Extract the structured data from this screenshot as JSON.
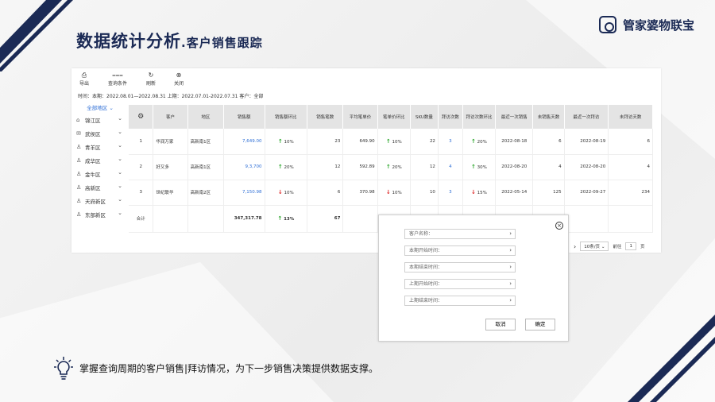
{
  "slide": {
    "title_main": "数据统计分析",
    "title_sub": ".客户销售跟踪",
    "brand_name": "管家婆物联宝",
    "caption": "掌握查询周期的客户销售|拜访情况，为下一步销售决策提供数据支撑。"
  },
  "toolbar": {
    "items": [
      {
        "label": "导出",
        "icon": "export-icon"
      },
      {
        "label": "查询条件",
        "icon": "filter-icon"
      },
      {
        "label": "刷新",
        "icon": "refresh-icon"
      },
      {
        "label": "关闭",
        "icon": "close-icon"
      }
    ]
  },
  "filter": {
    "text": "时间：本期：2022.08.01—2022.08.31  上期：2022.07.01-2022.07.31    客户：全部"
  },
  "sidebar": {
    "all_label": "全部地区",
    "items": [
      {
        "label": "锦江区",
        "icon": "home-icon"
      },
      {
        "label": "武侯区",
        "icon": "mail-icon"
      },
      {
        "label": "青羊区",
        "icon": "user-icon"
      },
      {
        "label": "成华区",
        "icon": "user-icon"
      },
      {
        "label": "金牛区",
        "icon": "user-icon"
      },
      {
        "label": "高新区",
        "icon": "user-icon"
      },
      {
        "label": "天府新区",
        "icon": "user-icon"
      },
      {
        "label": "东部新区",
        "icon": "user-icon"
      }
    ]
  },
  "table": {
    "headers": [
      "客户",
      "地区",
      "销售额",
      "销售额环比",
      "销售笔数",
      "平均笔单价",
      "笔单价环比",
      "SKU数量",
      "拜访次数",
      "拜访次数环比",
      "最近一次销售",
      "未销售天数",
      "最近一次拜访",
      "未拜访天数"
    ],
    "rows": [
      {
        "no": "1",
        "customer": "华润万家",
        "region": "高新南1区",
        "sales": "7,649.00",
        "sales_trend": "up",
        "sales_mom": "10%",
        "orders": "23",
        "avg_price": "649.90",
        "avg_trend": "up",
        "avg_mom": "10%",
        "sku": "22",
        "visits": "3",
        "visit_trend": "up",
        "visit_mom": "20%",
        "last_sale": "2022-08-18",
        "unsold_days": "6",
        "last_visit": "2022-08-19",
        "unvisited_days": "6"
      },
      {
        "no": "2",
        "customer": "好又多",
        "region": "高新南1区",
        "sales": "9,3,700",
        "sales_trend": "up",
        "sales_mom": "20%",
        "orders": "12",
        "avg_price": "592.89",
        "avg_trend": "up",
        "avg_mom": "20%",
        "sku": "12",
        "visits": "4",
        "visit_trend": "up",
        "visit_mom": "30%",
        "last_sale": "2022-08-20",
        "unsold_days": "4",
        "last_visit": "2022-08-20",
        "unvisited_days": "4"
      },
      {
        "no": "3",
        "customer": "世纪联华",
        "region": "高新南2区",
        "sales": "7,150.98",
        "sales_trend": "down",
        "sales_mom": "10%",
        "orders": "6",
        "avg_price": "370.98",
        "avg_trend": "down",
        "avg_mom": "10%",
        "sku": "10",
        "visits": "3",
        "visit_trend": "down",
        "visit_mom": "15%",
        "last_sale": "2022-05-14",
        "unsold_days": "125",
        "last_visit": "2022-09-27",
        "unvisited_days": "234"
      }
    ],
    "summary": {
      "label": "合计",
      "sales": "347,317.78",
      "sales_mom": "13%",
      "orders": "67"
    }
  },
  "pager": {
    "page_size": "10条/页",
    "goto_label": "前往",
    "page": "1",
    "page_unit": "页"
  },
  "dialog": {
    "fields": [
      "客户名称：",
      "本期开始时间：",
      "本期结束时间：",
      "上期开始时间：",
      "上期结束时间："
    ],
    "cancel": "取消",
    "confirm": "确定"
  },
  "colors": {
    "navy": "#1b2a55",
    "link": "#2f6fd6",
    "up": "#2aa52a",
    "down": "#dd2222"
  }
}
